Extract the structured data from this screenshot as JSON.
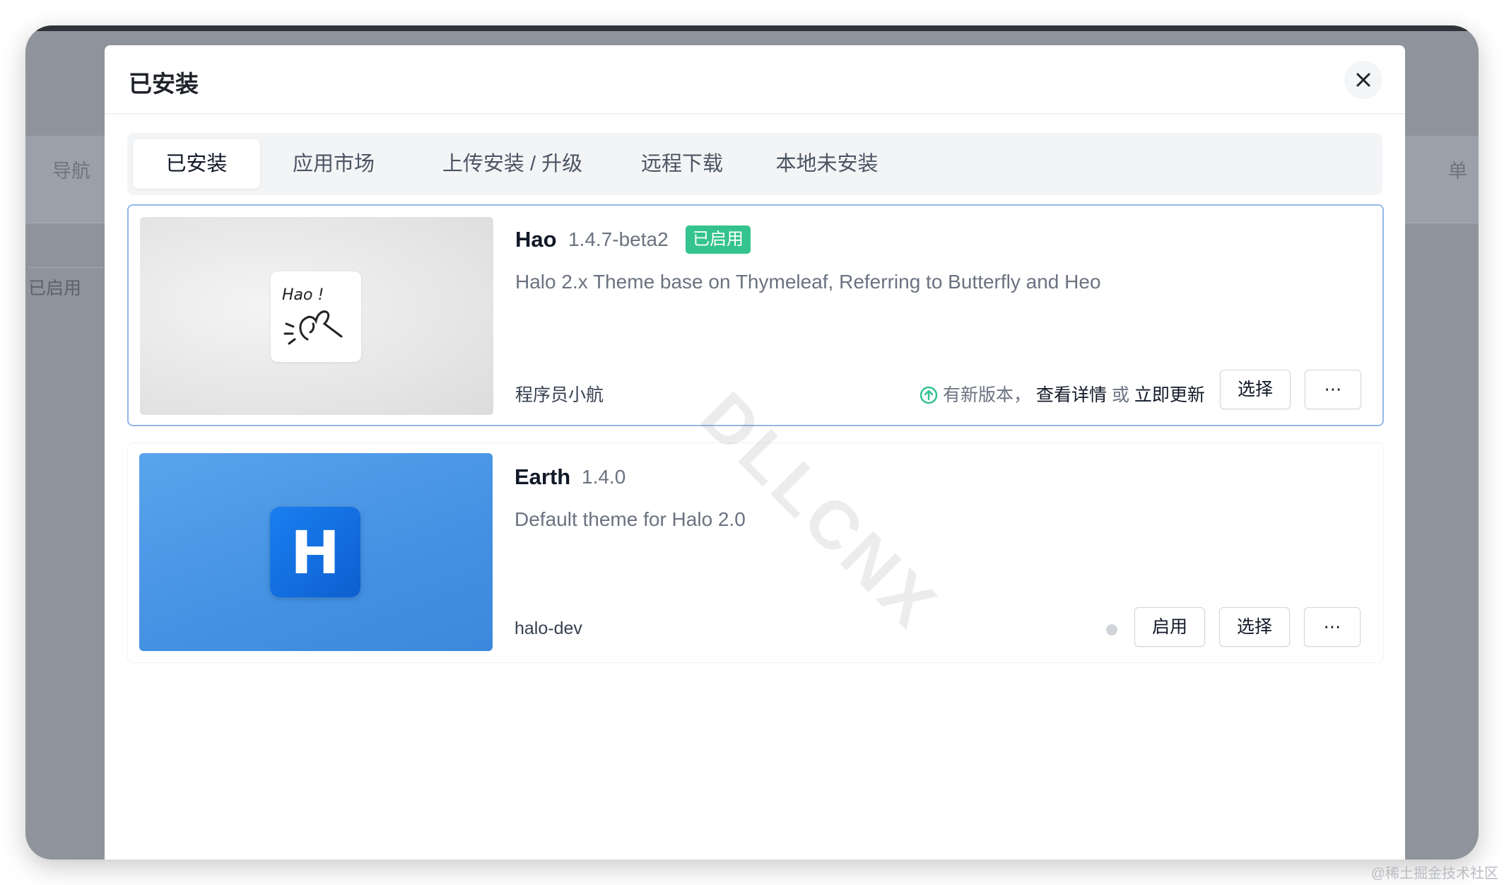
{
  "background": {
    "nav_label": "导航",
    "right_label": "单",
    "enabled_label": "已启用"
  },
  "modal": {
    "title": "已安装",
    "close_icon": "close-icon"
  },
  "tabs": [
    {
      "label": "已安装",
      "active": true
    },
    {
      "label": "应用市场",
      "active": false
    },
    {
      "label": "上传安装 / 升级",
      "active": false
    },
    {
      "label": "远程下载",
      "active": false
    },
    {
      "label": "本地未安装",
      "active": false
    }
  ],
  "themes": [
    {
      "name": "Hao",
      "version": "1.4.7-beta2",
      "badge": "已启用",
      "description": "Halo 2.x Theme base on Thymeleaf, Referring to Butterfly and Heo",
      "author": "程序员小航",
      "logo_text": "Hao !",
      "update_prefix": "有新版本，",
      "update_detail": "查看详情",
      "update_or": "或",
      "update_now": "立即更新",
      "select_label": "选择",
      "more_label": "⋯"
    },
    {
      "name": "Earth",
      "version": "1.4.0",
      "description": "Default theme for Halo 2.0",
      "author": "halo-dev",
      "logo_text": "H",
      "enable_label": "启用",
      "select_label": "选择",
      "more_label": "⋯"
    }
  ],
  "watermark": "DLLCNX",
  "credit": "@稀土掘金技术社区",
  "colors": {
    "badge": "#34c38f",
    "active_border": "#93b7e9",
    "update_icon": "#34c38f"
  }
}
